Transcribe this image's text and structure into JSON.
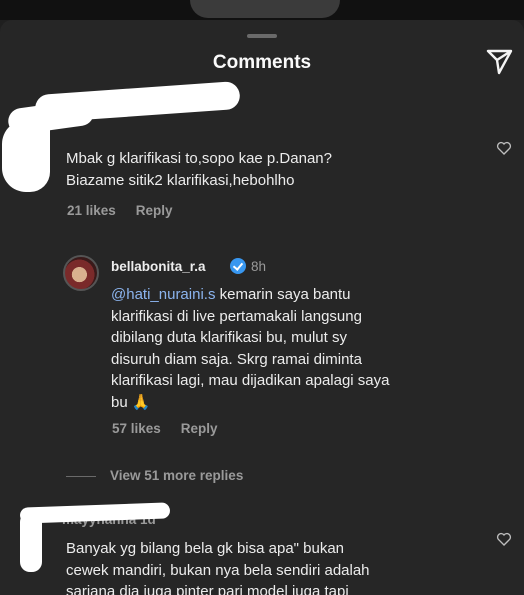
{
  "header": {
    "title": "Comments",
    "share_icon": "send-icon"
  },
  "comment1": {
    "text_line1": "Mbak g klarifikasi to,sopo kae p.Danan?",
    "text_line2": "Biazame sitik2 klarifikasi,hebohlho",
    "likes": "21 likes",
    "reply": "Reply"
  },
  "reply1": {
    "username": "bellabonita_r.a",
    "time": "8h",
    "mention": "@hati_nuraini.s",
    "line1": " kemarin saya bantu",
    "line2": "klarifikasi di live pertamakali langsung",
    "line3": "dibilang duta klarifikasi bu, mulut sy",
    "line4": "disuruh diam saja. Skrg ramai diminta",
    "line5": "klarifikasi lagi, mau dijadikan apalagi saya",
    "line6": "bu 🙏",
    "likes": "57 likes",
    "reply": "Reply"
  },
  "view_more": "View 51 more replies",
  "comment2": {
    "username_partial": "mayyhanna 1d",
    "line1": "Banyak yg bilang bela gk bisa apa\" bukan",
    "line2": "cewek mandiri, bukan nya bela sendiri adalah",
    "line3": "sarjana dia juga pinter pari model juga tapi"
  },
  "colors": {
    "background": "#262626",
    "verified": "#3897f0",
    "mention": "#8bb4ee"
  }
}
